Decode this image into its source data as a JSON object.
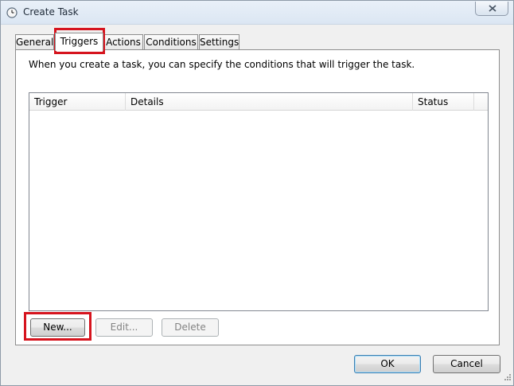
{
  "window": {
    "title": "Create Task",
    "colors": {
      "highlight": "#d6141e",
      "panel_bg": "#ffffff",
      "window_bg": "#f0f0f0"
    }
  },
  "tabs": [
    {
      "label": "General",
      "active": false
    },
    {
      "label": "Triggers",
      "active": true
    },
    {
      "label": "Actions",
      "active": false
    },
    {
      "label": "Conditions",
      "active": false
    },
    {
      "label": "Settings",
      "active": false
    }
  ],
  "triggers_panel": {
    "description": "When you create a task, you can specify the conditions that will trigger the task.",
    "columns": [
      "Trigger",
      "Details",
      "Status"
    ],
    "rows": [],
    "buttons": {
      "new": "New...",
      "edit": "Edit...",
      "delete": "Delete"
    }
  },
  "footer": {
    "ok": "OK",
    "cancel": "Cancel"
  },
  "icons": {
    "window": "clock-icon",
    "close": "close-icon",
    "resize": "resize-grip-icon"
  }
}
